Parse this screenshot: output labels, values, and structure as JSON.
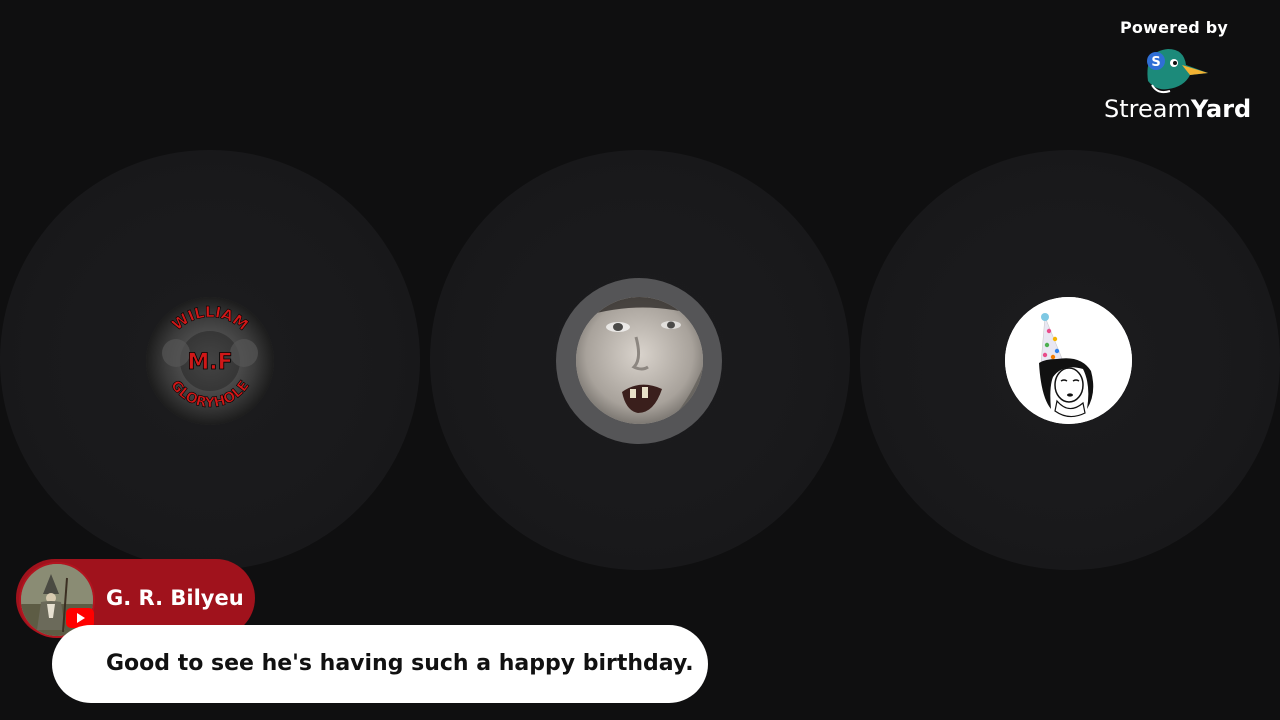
{
  "branding": {
    "powered_by": "Powered by",
    "brand_part1": "Stream",
    "brand_part2": "Yard",
    "logo_icon": "duck-icon"
  },
  "participants": [
    {
      "avatar": "skull-logo-avatar",
      "logo_text_top": "WILLIAM",
      "logo_text_middle": "M.F",
      "logo_text_bottom": "GLORYHOLE"
    },
    {
      "avatar": "face-avatar",
      "speaking": true
    },
    {
      "avatar": "party-hat-girl-avatar"
    }
  ],
  "comment": {
    "author": "G. R. Bilyeu",
    "platform_icon": "youtube-icon",
    "text": "Good to see he's having such a happy birthday."
  },
  "colors": {
    "background": "#0f0f10",
    "tile": "#1a1a1c",
    "name_pill": "#a0121c",
    "youtube": "#ff0000",
    "bubble": "#ffffff"
  }
}
